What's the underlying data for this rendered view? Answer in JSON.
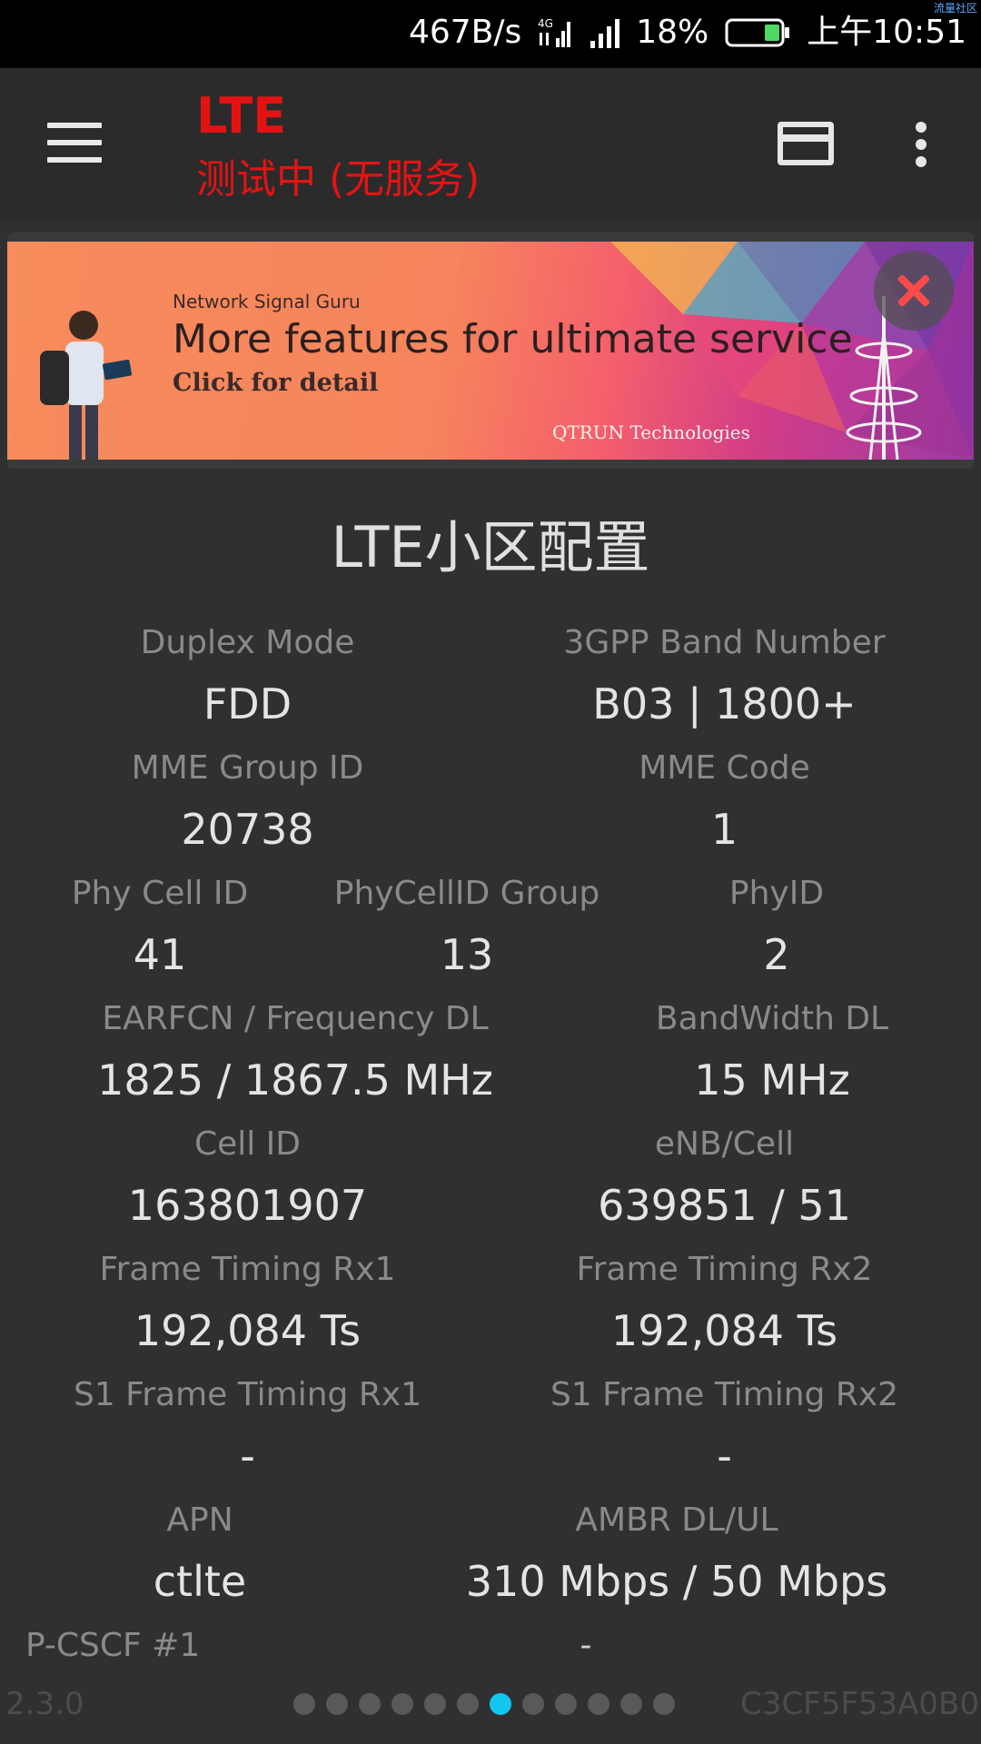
{
  "status_bar": {
    "carrier_tag": "流量社区",
    "net_speed": "467B/s",
    "network_type": "4G",
    "battery": "18%",
    "time": "上午10:51"
  },
  "app_bar": {
    "title": "LTE",
    "subtitle": "测试中 (无服务)",
    "menu_icon": "hamburger-menu-icon",
    "card_icon": "card-view-icon",
    "more_icon": "more-vert-icon"
  },
  "banner": {
    "brand": "Network Signal Guru",
    "headline": "More features for ultimate service",
    "cta": "Click for detail",
    "company": "QTRUN Technologies",
    "close_icon": "close-icon"
  },
  "section": {
    "title": "LTE小区配置"
  },
  "fields": {
    "duplex_mode": {
      "label": "Duplex Mode",
      "value": "FDD"
    },
    "band": {
      "label": "3GPP Band Number",
      "value": "B03 | 1800+"
    },
    "mme_group": {
      "label": "MME Group ID",
      "value": "20738"
    },
    "mme_code": {
      "label": "MME Code",
      "value": "1"
    },
    "phy_cell_id": {
      "label": "Phy Cell ID",
      "value": "41"
    },
    "phy_group": {
      "label": "PhyCellID Group",
      "value": "13"
    },
    "phy_id": {
      "label": "PhyID",
      "value": "2"
    },
    "earfcn": {
      "label": "EARFCN / Frequency DL",
      "value": "1825 / 1867.5 MHz"
    },
    "bandwidth": {
      "label": "BandWidth DL",
      "value": "15 MHz"
    },
    "cell_id": {
      "label": "Cell ID",
      "value": "163801907"
    },
    "enb_cell": {
      "label": "eNB/Cell",
      "value": "639851 / 51"
    },
    "ft_rx1": {
      "label": "Frame Timing Rx1",
      "value": "192,084 Ts"
    },
    "ft_rx2": {
      "label": "Frame Timing Rx2",
      "value": "192,084 Ts"
    },
    "s1_rx1": {
      "label": "S1 Frame Timing Rx1",
      "value": "-"
    },
    "s1_rx2": {
      "label": "S1 Frame Timing Rx2",
      "value": "-"
    },
    "apn": {
      "label": "APN",
      "value": "ctlte"
    },
    "ambr": {
      "label": "AMBR DL/UL",
      "value": "310 Mbps / 50 Mbps"
    },
    "pcscf": {
      "label": "P-CSCF #1",
      "value": "-"
    }
  },
  "footer": {
    "version": "2.3.0",
    "device_id": "C3CF5F53A0B0",
    "page_count": 12,
    "active_page": 7
  },
  "colors": {
    "title_red": "#e41313",
    "active_dot": "#12c6f0",
    "background": "#303030"
  }
}
